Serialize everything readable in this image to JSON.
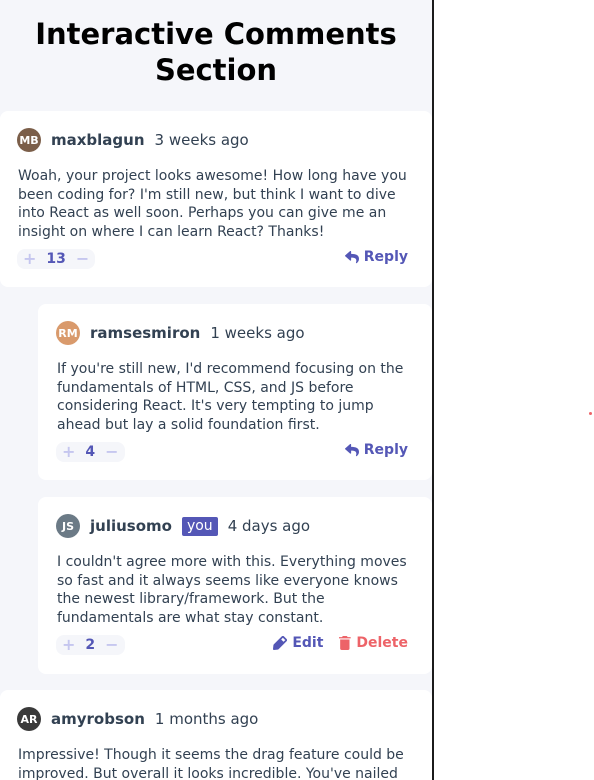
{
  "page": {
    "title_line1": "Interactive Comments",
    "title_line2": "Section"
  },
  "comments": [
    {
      "avatar_initials": "MB",
      "avatar_color": "#7b5e49",
      "username": "maxblagun",
      "date": "3 weeks ago",
      "content": "Woah, your project looks awesome! How long have you been coding for? I'm still new, but think I want to dive into React as well soon. Perhaps you can give me an insight on where I can learn React? Thanks!",
      "score": "13",
      "reply_label": "Reply"
    },
    {
      "avatar_initials": "RM",
      "avatar_color": "#d99a6c",
      "username": "ramsesmiron",
      "date": "1 weeks ago",
      "content": "If you're still new, I'd recommend focusing on the fundamentals of HTML, CSS, and JS before considering React. It's very tempting to jump ahead but lay a solid foundation first.",
      "score": "4",
      "reply_label": "Reply"
    },
    {
      "avatar_initials": "JS",
      "avatar_color": "#6b7a86",
      "username": "juliusomo",
      "badge": "you",
      "date": "4 days ago",
      "content": "I couldn't agree more with this. Everything moves so fast and it always seems like everyone knows the newest library/framework. But the fundamentals are what stay constant.",
      "score": "2",
      "edit_label": "Edit",
      "delete_label": "Delete"
    },
    {
      "avatar_initials": "AR",
      "avatar_color": "#3a3a3a",
      "username": "amyrobson",
      "date": "1 months ago",
      "content": "Impressive! Though it seems the drag feature could be improved. But overall it looks incredible. You've nailed"
    }
  ],
  "vote": {
    "plus": "+",
    "minus": "−"
  },
  "colors": {
    "accent": "#5457b6",
    "danger": "#ed6368",
    "vote_icon": "#c5c6ef",
    "background": "#f5f6fa",
    "text": "#324152"
  }
}
